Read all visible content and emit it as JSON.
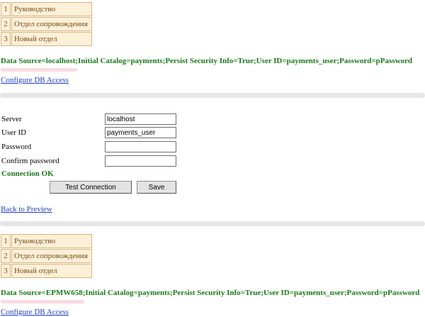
{
  "top_departments": [
    {
      "num": "1",
      "name": "Руководство"
    },
    {
      "num": "2",
      "name": "Отдел сопровождения"
    },
    {
      "num": "3",
      "name": "Новый отдел"
    }
  ],
  "top_connection_string": "Data Source=localhost;Initial Catalog=payments;Persist Security Info=True;User ID=payments_user;Password=pPassword",
  "configure_link": "Configure DB Access",
  "form": {
    "server_label": "Server",
    "server_value": "localhost",
    "userid_label": "User ID",
    "userid_value": "payments_user",
    "password_label": "Password",
    "password_value": "",
    "confirm_label": "Confirm password",
    "confirm_value": "",
    "status": "Connection OK",
    "test_button": "Test Connection",
    "save_button": "Save"
  },
  "back_link": "Back to Preview",
  "bottom_departments": [
    {
      "num": "1",
      "name": "Руководство"
    },
    {
      "num": "2",
      "name": "Отдел сопровождения"
    },
    {
      "num": "3",
      "name": "Новый отдел"
    }
  ],
  "bottom_connection_string": "Data Source=EPMW658;Initial Catalog=payments;Persist Security Info=True;User ID=payments_user;Password=pPassword",
  "bottom_configure_link": "Configure DB Access"
}
